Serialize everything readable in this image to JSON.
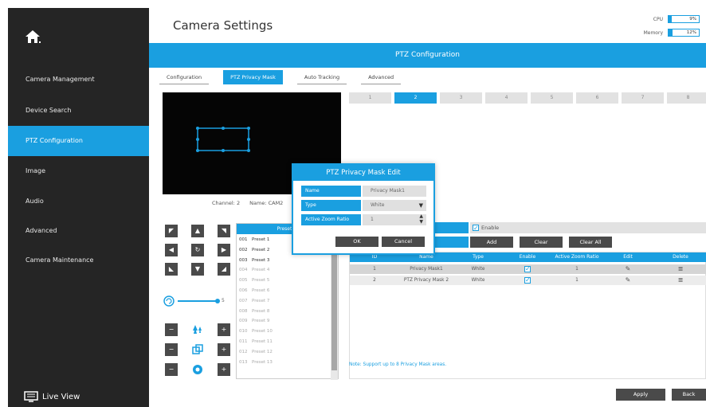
{
  "header": {
    "title": "Camera Settings",
    "cpu_label": "CPU",
    "cpu_value": "9%",
    "memory_label": "Memory",
    "memory_value": "12%"
  },
  "sidebar": {
    "items": [
      {
        "label": "Camera Management"
      },
      {
        "label": "Device Search"
      },
      {
        "label": "PTZ Configuration"
      },
      {
        "label": "Image"
      },
      {
        "label": "Audio"
      },
      {
        "label": "Advanced"
      },
      {
        "label": "Camera Maintenance"
      }
    ],
    "active_index": 2,
    "live_view": "Live View"
  },
  "ptz_header": "PTZ Configuration",
  "subtabs": [
    "Configuration",
    "PTZ Privacy Mask",
    "Auto Tracking",
    "Advanced"
  ],
  "active_subtab": 1,
  "channel_info": {
    "channel": "Channel: 2",
    "name": "Name: CAM2"
  },
  "mask_numbers": [
    "1",
    "2",
    "3",
    "4",
    "5",
    "6",
    "7",
    "8"
  ],
  "active_mask_number": 1,
  "speed_value": "5",
  "presets": {
    "header": "Preset",
    "rows": [
      {
        "id": "001",
        "name": "Preset 1"
      },
      {
        "id": "002",
        "name": "Preset 2"
      },
      {
        "id": "003",
        "name": "Preset 3"
      },
      {
        "id": "004",
        "name": "Preset 4"
      },
      {
        "id": "005",
        "name": "Preset 5"
      },
      {
        "id": "006",
        "name": "Preset 6"
      },
      {
        "id": "007",
        "name": "Preset 7"
      },
      {
        "id": "008",
        "name": "Preset 8"
      },
      {
        "id": "009",
        "name": "Preset 9"
      },
      {
        "id": "010",
        "name": "Preset 10"
      },
      {
        "id": "011",
        "name": "Preset 11"
      },
      {
        "id": "012",
        "name": "Preset 12"
      },
      {
        "id": "013",
        "name": "Preset 13"
      }
    ]
  },
  "enable_label": "Enable",
  "actions": {
    "add": "Add",
    "clear": "Clear",
    "clear_all": "Clear All"
  },
  "table": {
    "columns": [
      "ID",
      "Name",
      "Type",
      "Enable",
      "Active Zoom Ratio",
      "Edit",
      "Delete"
    ],
    "rows": [
      {
        "id": "1",
        "name": "Privacy Mask1",
        "type": "White",
        "zoom": "1"
      },
      {
        "id": "2",
        "name": "PTZ Privacy Mask 2",
        "type": "White",
        "zoom": "1"
      }
    ]
  },
  "note": "Note: Support up to 8 Privacy Mask areas.",
  "footer": {
    "apply": "Apply",
    "back": "Back"
  },
  "dialog": {
    "title": "PTZ Privacy Mask Edit",
    "name_label": "Name",
    "name_value": "Privacy Mask1",
    "type_label": "Type",
    "type_value": "White",
    "zoom_label": "Active Zoom Ratio",
    "zoom_value": "1",
    "ok": "OK",
    "cancel": "Cancel"
  },
  "colors": {
    "accent": "#1a9fe0",
    "sidebar": "#252525",
    "button": "#4a4a4a"
  }
}
